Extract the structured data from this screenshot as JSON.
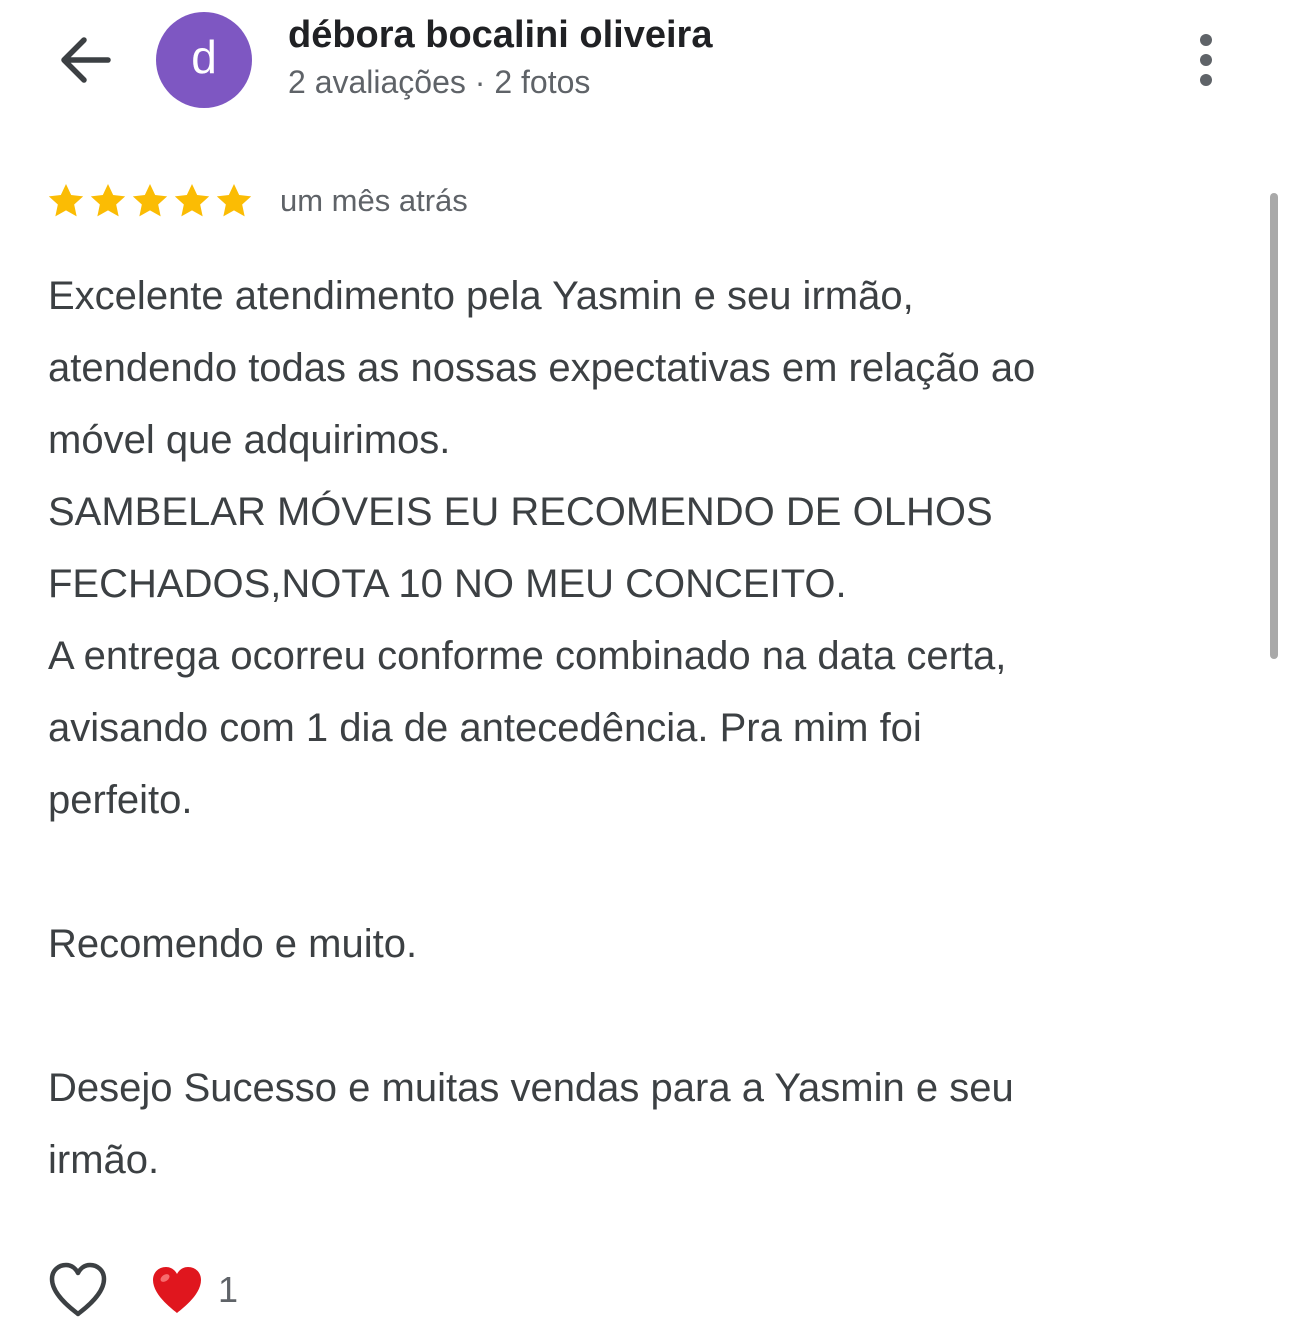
{
  "header": {
    "back_icon": "arrow-left-icon",
    "avatar_letter": "d",
    "avatar_color": "#7e57c2",
    "user_name": "débora bocalini oliveira",
    "user_meta": "2 avaliações · 2 fotos",
    "menu_icon": "more-vert-icon"
  },
  "review": {
    "rating": 5,
    "rating_max": 5,
    "star_color": "#fbbc04",
    "time": "um mês atrás",
    "text": "Excelente atendimento pela Yasmin e seu irmão,\natendendo todas as nossas expectativas em relação ao\nmóvel que adquirimos.\nSAMBELAR MÓVEIS EU RECOMENDO DE OLHOS\nFECHADOS,NOTA 10 NO MEU CONCEITO.\nA entrega ocorreu conforme combinado na data certa,\navisando com 1 dia de antecedência. Pra mim foi\nperfeito.\n\nRecomendo e muito.\n\nDesejo Sucesso e muitas vendas para a Yasmin e seu\nirmão."
  },
  "actions": {
    "like_icon": "heart-outline-icon",
    "reaction_icon": "red-heart-emoji-icon",
    "reaction_count": "1"
  }
}
